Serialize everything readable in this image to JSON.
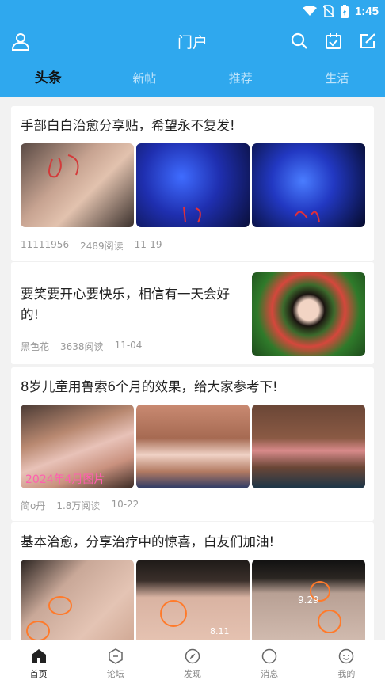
{
  "status": {
    "time": "1:45"
  },
  "header": {
    "title": "门户"
  },
  "tabs": [
    {
      "label": "头条",
      "active": true
    },
    {
      "label": "新帖",
      "active": false
    },
    {
      "label": "推荐",
      "active": false
    },
    {
      "label": "生活",
      "active": false
    }
  ],
  "posts": [
    {
      "title": "手部白白治愈分享贴，希望永不复发!",
      "author": "11111956",
      "reads": "2489阅读",
      "date": "11-19"
    },
    {
      "title_line1": "要笑要开心要快乐，相信有一天会好",
      "title_line2": "的!",
      "author": "黑色花",
      "reads": "3638阅读",
      "date": "11-04"
    },
    {
      "title": "8岁儿童用鲁索6个月的效果，给大家参考下!",
      "author": "简o丹",
      "reads": "1.8万阅读",
      "date": "10-22",
      "photo_caption": "2024年4月图片"
    },
    {
      "title": "基本治愈，分享治疗中的惊喜，白友们加油!",
      "photo_label_1": "9.29",
      "photo_label_2": "8.11"
    }
  ],
  "bottom_nav": [
    {
      "label": "首页",
      "icon": "home-icon",
      "active": true
    },
    {
      "label": "论坛",
      "icon": "forum-icon",
      "active": false
    },
    {
      "label": "发现",
      "icon": "compass-icon",
      "active": false
    },
    {
      "label": "消息",
      "icon": "message-icon",
      "active": false
    },
    {
      "label": "我的",
      "icon": "profile-icon",
      "active": false
    }
  ],
  "colors": {
    "primary": "#2fa8ee",
    "background": "#f2f2f2"
  }
}
